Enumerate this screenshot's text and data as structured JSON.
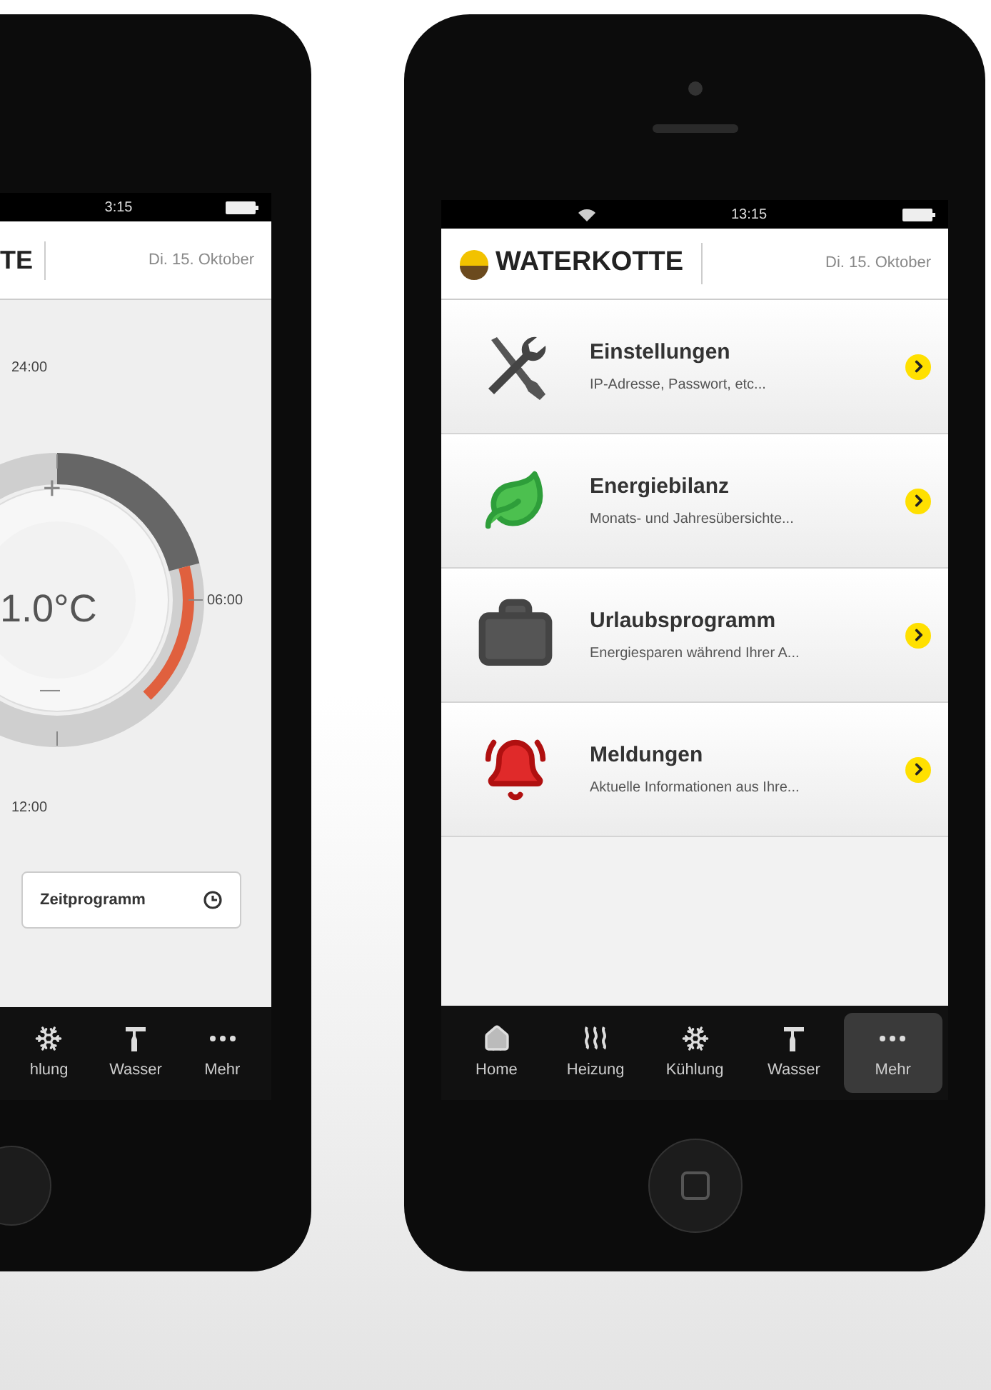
{
  "left_phone": {
    "status_bar": {
      "time": "3:15"
    },
    "header": {
      "logo_text": "TE",
      "date": "Di. 15. Oktober"
    },
    "dial": {
      "temperature": "1.0°C",
      "plus": "+",
      "minus": "—",
      "labels": [
        "24:00",
        "06:00",
        "12:00"
      ]
    },
    "button": {
      "label": "Zeitprogramm"
    },
    "tab_bar": [
      {
        "label": "hlung",
        "selected": false
      },
      {
        "label": "Wasser",
        "selected": false
      },
      {
        "label": "Mehr",
        "selected": false
      }
    ]
  },
  "right_phone": {
    "status_bar": {
      "time": "13:15"
    },
    "header": {
      "logo_text": "WATERKOTTE",
      "date": "Di. 15. Oktober"
    },
    "menu_items": [
      {
        "title": "Einstellungen",
        "subtitle": "IP-Adresse, Passwort, etc..."
      },
      {
        "title": "Energiebilanz",
        "subtitle": "Monats- und Jahresübersichte..."
      },
      {
        "title": "Urlaubsprogramm",
        "subtitle": "Energiesparen während Ihrer A..."
      },
      {
        "title": "Meldungen",
        "subtitle": "Aktuelle Informationen aus Ihre..."
      }
    ],
    "tab_bar": [
      {
        "label": "Home",
        "selected": false
      },
      {
        "label": "Heizung",
        "selected": false
      },
      {
        "label": "Kühlung",
        "selected": false
      },
      {
        "label": "Wasser",
        "selected": false
      },
      {
        "label": "Mehr",
        "selected": true
      }
    ]
  }
}
